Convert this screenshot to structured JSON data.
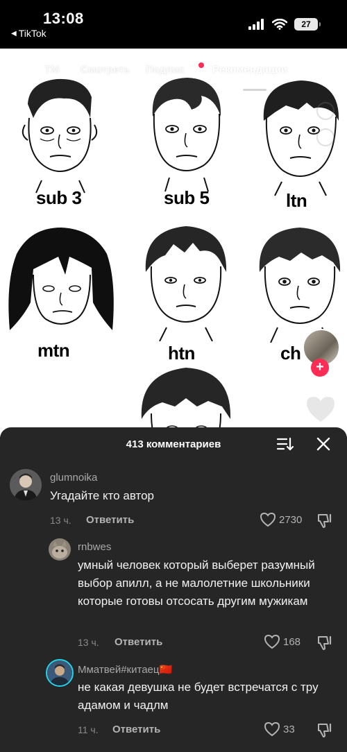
{
  "status_bar": {
    "time": "13:08",
    "back_app": "TikTok",
    "battery": "27"
  },
  "top_nav": {
    "tabs": [
      {
        "label": "ТМ"
      },
      {
        "label": "Смотреть"
      },
      {
        "label": "Подпис"
      },
      {
        "label": "Рекомендации"
      }
    ],
    "icons": [
      "live-tv-icon",
      "search-icon"
    ]
  },
  "video": {
    "captions": [
      "sub 3",
      "sub 5",
      "ltn",
      "mtn",
      "htn",
      "ch"
    ]
  },
  "comments_sheet": {
    "title": "413 комментариев",
    "icons": [
      "sort-icon",
      "close-icon"
    ],
    "comments": [
      {
        "author": "glumnoika",
        "text": "Угадайте кто автор",
        "time": "13 ч.",
        "reply_label": "Ответить",
        "likes": "2730"
      },
      {
        "author": "rnbwes",
        "text": "умный человек который выберет разумный выбор апилл, а не малолетние школьники которые готовы отсосать другим мужикам",
        "time": "13 ч.",
        "reply_label": "Ответить",
        "likes": "168"
      },
      {
        "author": "Mматвей#китаец🇨🇳",
        "text": "не какая девушка не будет встречатся с тру адамом и чадлм",
        "time": "11 ч.",
        "reply_label": "Ответить",
        "likes": "33"
      }
    ]
  },
  "colors": {
    "accent": "#fe2c55",
    "sheet_bg": "#262626",
    "muted_text": "#a8a8a8"
  }
}
